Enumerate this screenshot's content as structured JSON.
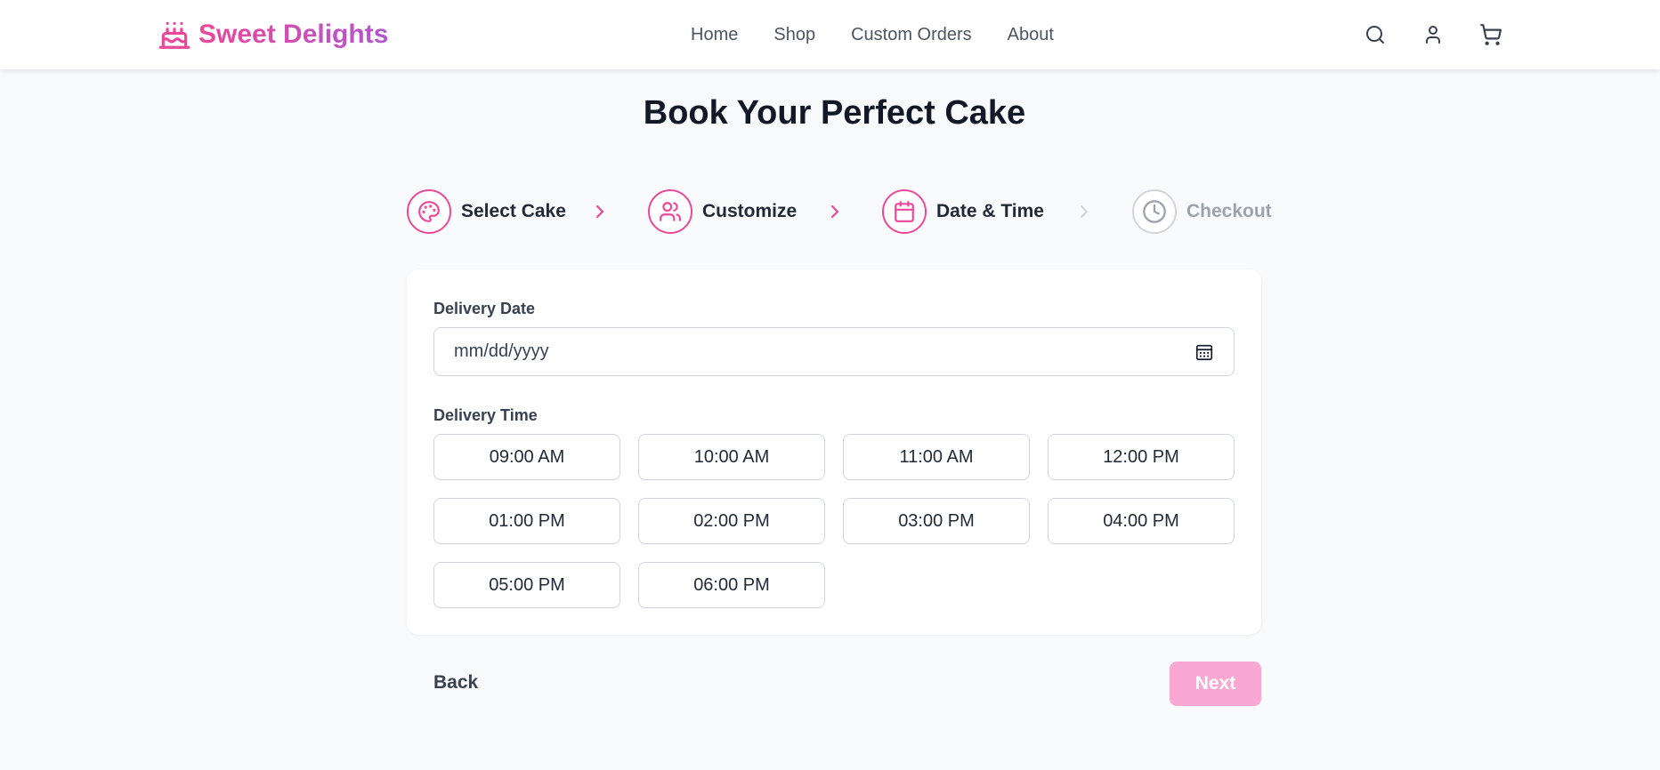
{
  "brand": {
    "name": "Sweet Delights",
    "icon": "cake-icon"
  },
  "nav": [
    {
      "label": "Home"
    },
    {
      "label": "Shop"
    },
    {
      "label": "Custom Orders"
    },
    {
      "label": "About"
    }
  ],
  "header_icons": [
    "search-icon",
    "user-icon",
    "cart-icon"
  ],
  "page_title": "Book Your Perfect Cake",
  "steps": [
    {
      "label": "Select Cake",
      "icon": "palette-icon",
      "active": true
    },
    {
      "label": "Customize",
      "icon": "users-icon",
      "active": true
    },
    {
      "label": "Date & Time",
      "icon": "calendar-icon",
      "active": true
    },
    {
      "label": "Checkout",
      "icon": "clock-icon",
      "active": false
    }
  ],
  "form": {
    "date_label": "Delivery Date",
    "date_placeholder": "mm/dd/yyyy",
    "time_label": "Delivery Time",
    "times": [
      "09:00 AM",
      "10:00 AM",
      "11:00 AM",
      "12:00 PM",
      "01:00 PM",
      "02:00 PM",
      "03:00 PM",
      "04:00 PM",
      "05:00 PM",
      "06:00 PM"
    ]
  },
  "actions": {
    "back": "Back",
    "next": "Next"
  },
  "colors": {
    "accent": "#ec4899",
    "accent_purple": "#b256d0",
    "next_disabled": "#f9a8d4",
    "inactive": "#d1d5db"
  }
}
